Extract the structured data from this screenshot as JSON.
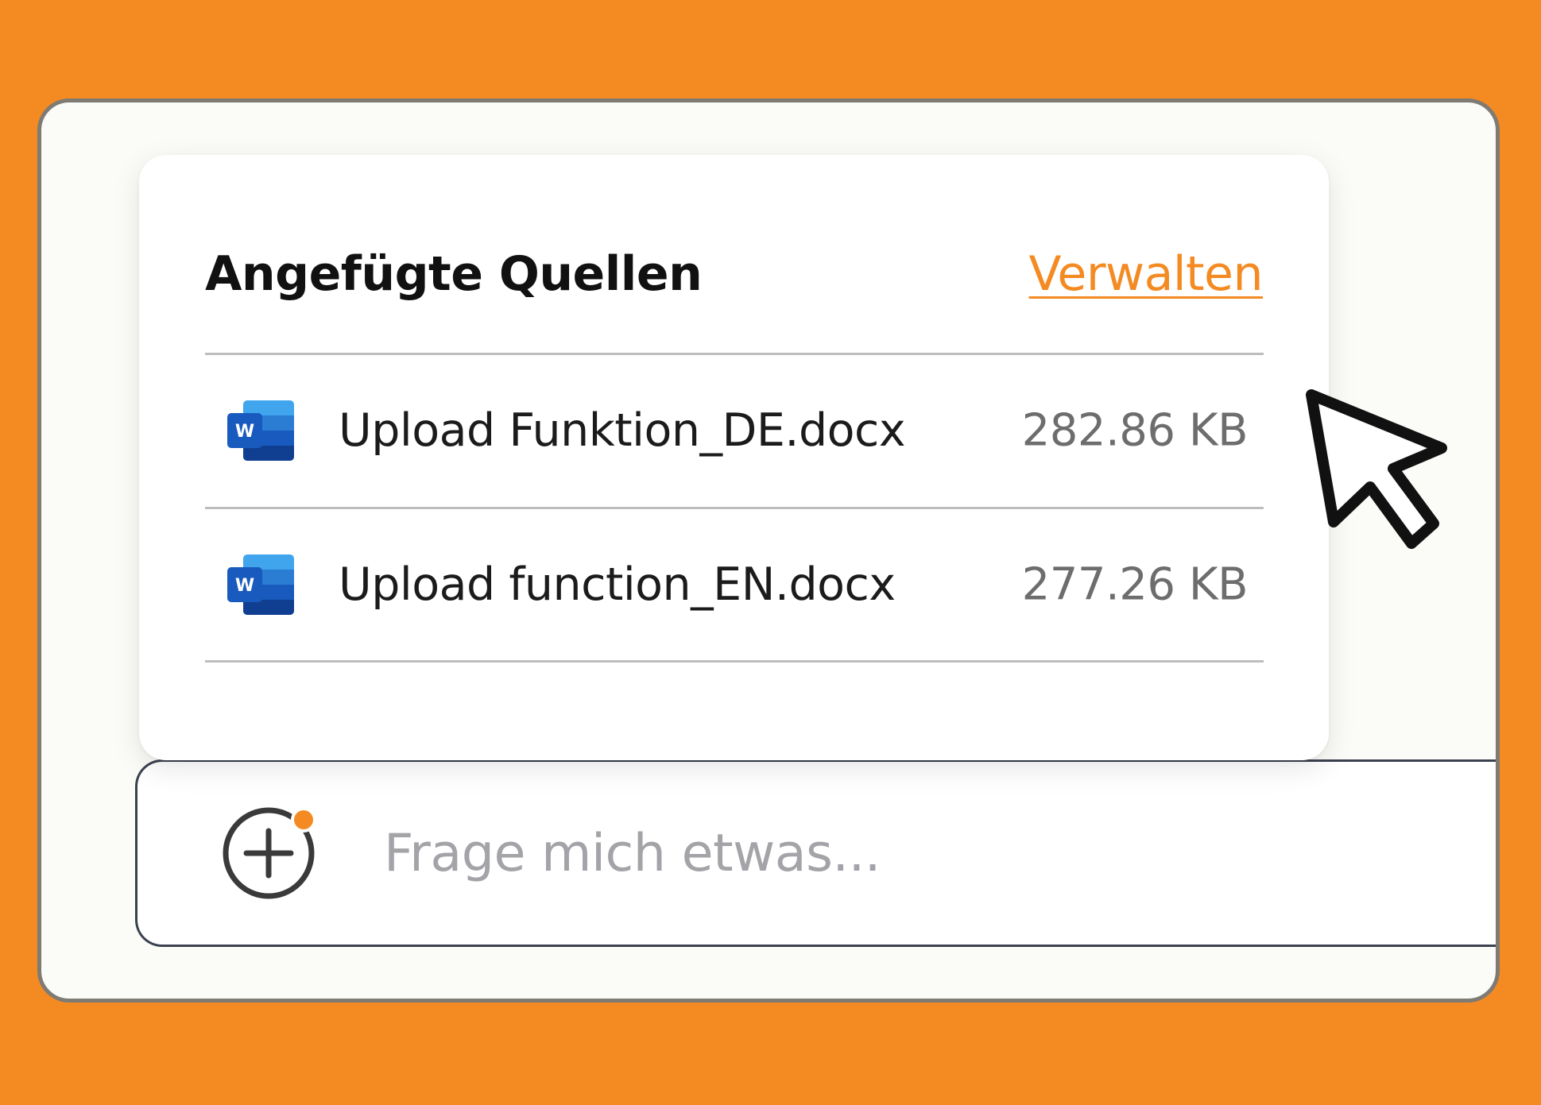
{
  "colors": {
    "background": "#F48A22",
    "accent": "#F48A22",
    "frame_border": "#7E7A74",
    "word_blue": "#185ABD"
  },
  "sources_popover": {
    "title": "Angefügte Quellen",
    "manage_label": "Verwalten",
    "files": [
      {
        "name": "Upload Funktion_DE.docx",
        "size": "282.86 KB",
        "icon": "word-doc-icon"
      },
      {
        "name": "Upload function_EN.docx",
        "size": "277.26 KB",
        "icon": "word-doc-icon"
      }
    ]
  },
  "composer": {
    "placeholder": "Frage mich etwas...",
    "value": "",
    "add_icon": "plus-circle-icon",
    "add_badge": "notification-dot"
  },
  "cursor": {
    "icon": "mouse-pointer-icon"
  }
}
